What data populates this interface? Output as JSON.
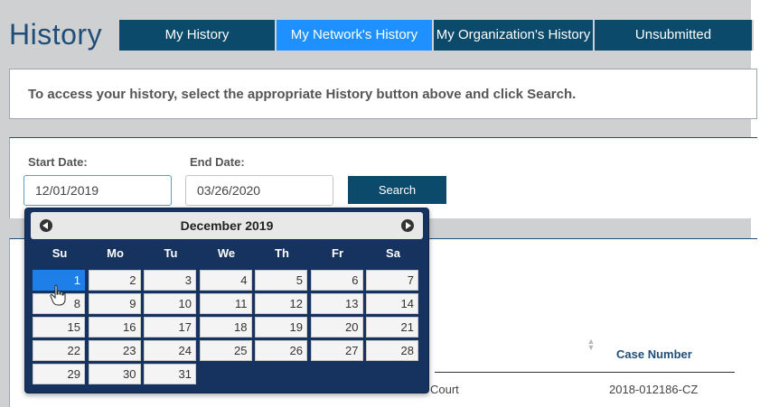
{
  "page": {
    "title": "History"
  },
  "tabs": [
    {
      "label": "My History",
      "active": false
    },
    {
      "label": "My Network's History",
      "active": true
    },
    {
      "label": "My Organization's History",
      "active": false
    },
    {
      "label": "Unsubmitted",
      "active": false
    }
  ],
  "info": {
    "text": "To access your history, select the appropriate History button above and click Search."
  },
  "search": {
    "start_label": "Start Date:",
    "start_value": "12/01/2019",
    "end_label": "End Date:",
    "end_value": "03/26/2020",
    "button_label": "Search"
  },
  "datepicker": {
    "title": "December 2019",
    "weekdays": [
      "Su",
      "Mo",
      "Tu",
      "We",
      "Th",
      "Fr",
      "Sa"
    ],
    "weeks": [
      [
        "1",
        "2",
        "3",
        "4",
        "5",
        "6",
        "7"
      ],
      [
        "8",
        "9",
        "10",
        "11",
        "12",
        "13",
        "14"
      ],
      [
        "15",
        "16",
        "17",
        "18",
        "19",
        "20",
        "21"
      ],
      [
        "22",
        "23",
        "24",
        "25",
        "26",
        "27",
        "28"
      ],
      [
        "29",
        "30",
        "31"
      ]
    ],
    "selected_day": "1"
  },
  "results": {
    "column_header": "Case Number",
    "row_court": "Court",
    "row_case_number": "2018-012186-CZ"
  },
  "colors": {
    "tab_bg": "#0b4a6b",
    "tab_active": "#1e90ff",
    "calendar_bg": "#163360",
    "title_color": "#1f4e79"
  }
}
